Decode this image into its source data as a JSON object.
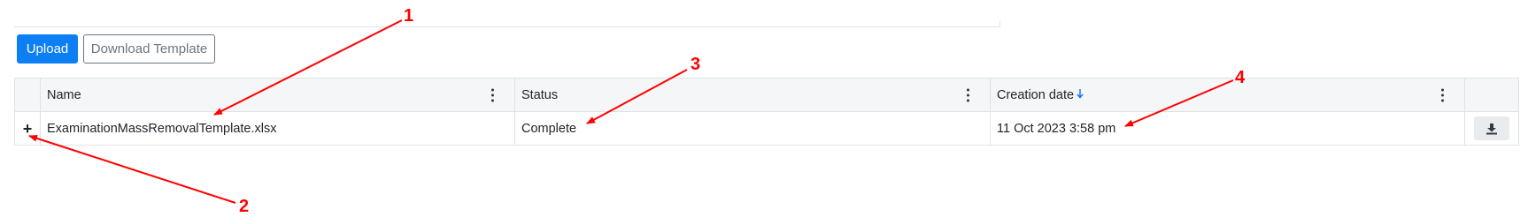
{
  "toolbar": {
    "upload_label": "Upload",
    "download_template_label": "Download Template"
  },
  "table": {
    "columns": [
      {
        "label": "Name"
      },
      {
        "label": "Status"
      },
      {
        "label": "Creation date",
        "sort_icon": "arrow-down-icon"
      }
    ],
    "rows": [
      {
        "expand": "+",
        "name": "ExaminationMassRemovalTemplate.xlsx",
        "status": "Complete",
        "creation_date": "11 Oct 2023 3:58 pm",
        "action_icon": "download-icon"
      }
    ]
  },
  "annotations": [
    "1",
    "2",
    "3",
    "4"
  ],
  "colors": {
    "primary": "#0d7ff5",
    "annotation": "#ff0000",
    "header_bg": "#f5f6f8",
    "border": "#dee2e6"
  }
}
